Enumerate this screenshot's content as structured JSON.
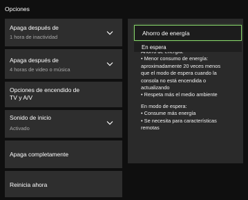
{
  "page": {
    "title": "Opciones"
  },
  "settings": [
    {
      "label": "Apaga después de",
      "value": "1 hora de inactividad"
    },
    {
      "label": "Apaga después de",
      "value": "4 horas de video o música"
    },
    {
      "label_lines": [
        "Opciones de encendido de",
        "TV y A/V"
      ]
    },
    {
      "label": "Sonido de inicio",
      "value": "Activado"
    },
    {
      "label": "Apaga completamente"
    },
    {
      "label": "Reinicia ahora"
    }
  ],
  "dropdown": {
    "options": [
      "Ahorro de energía",
      "En espera"
    ],
    "selected": "Ahorro de energía"
  },
  "info_panel": {
    "energy_saver_lines": [
      "Ahorro de energía:",
      "• Menor consumo de energía:",
      "aproximadamente 20 veces menos",
      "que el modo de espera cuando la",
      "consola no está encendida o",
      "actualizando",
      "• Respeta más el medio ambiente"
    ],
    "standby_lines": [
      "En modo de espera:",
      "• Consume más energía",
      "• Se necesita para características",
      "remotas"
    ]
  },
  "colors": {
    "background": "#0f0f0f",
    "tile": "#2e2e2e",
    "panel": "#2a2a2a",
    "focus_border": "#86d36a",
    "secondary_text": "#a9a9a9"
  }
}
